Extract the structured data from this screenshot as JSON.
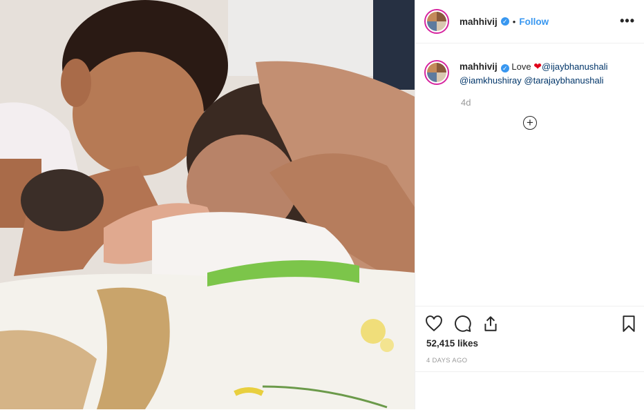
{
  "post": {
    "photo_icon": "photo-image",
    "username": "mahhivij",
    "verified_mark": "✓",
    "separator": "•",
    "follow_label": "Follow",
    "more_label": "•••",
    "caption": {
      "username": "mahhivij",
      "word": "Love",
      "heart": "❤",
      "mentions": [
        "@ijaybhanushali",
        "@iamkhushiray",
        "@tarajaybhanushali"
      ]
    },
    "age": "4d",
    "load_more_label": "+",
    "likes": "52,415 likes",
    "time_ago": "4 DAYS AGO",
    "colors": {
      "link": "#3897f0",
      "mention": "#003569",
      "heart": "#e0001a"
    }
  }
}
